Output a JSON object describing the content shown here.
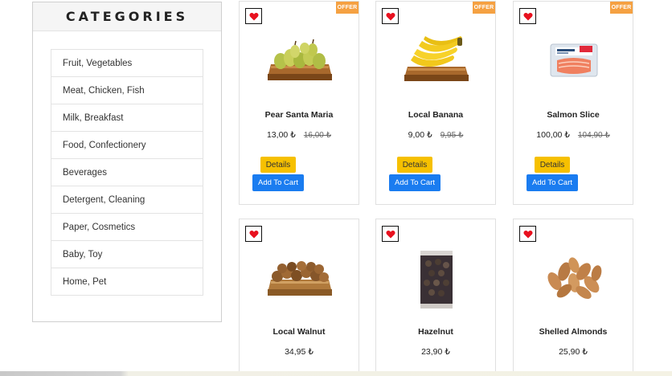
{
  "categories": {
    "title": "CATEGORIES",
    "items": [
      {
        "label": "Fruit, Vegetables"
      },
      {
        "label": "Meat, Chicken, Fish"
      },
      {
        "label": "Milk, Breakfast"
      },
      {
        "label": "Food, Confectionery"
      },
      {
        "label": "Beverages"
      },
      {
        "label": "Detergent, Cleaning"
      },
      {
        "label": "Paper, Cosmetics"
      },
      {
        "label": "Baby, Toy"
      },
      {
        "label": "Home, Pet"
      }
    ]
  },
  "products": [
    {
      "name": "Pear Santa Maria",
      "price": "13,00 ₺",
      "old_price": "16,00 ₺",
      "badge": "OFFER",
      "details_label": "Details",
      "cart_label": "Add To Cart"
    },
    {
      "name": "Local Banana",
      "price": "9,00 ₺",
      "old_price": "9,95 ₺",
      "badge": "OFFER",
      "details_label": "Details",
      "cart_label": "Add To Cart"
    },
    {
      "name": "Salmon Slice",
      "price": "100,00 ₺",
      "old_price": "104,90 ₺",
      "badge": "OFFER",
      "details_label": "Details",
      "cart_label": "Add To Cart"
    },
    {
      "name": "Local Walnut",
      "price": "34,95 ₺"
    },
    {
      "name": "Hazelnut",
      "price": "23,90 ₺"
    },
    {
      "name": "Shelled Almonds",
      "price": "25,90 ₺"
    }
  ],
  "icons": {
    "favorite": "heart-icon"
  },
  "colors": {
    "offer_badge": "#f5a142",
    "details_button": "#f6c000",
    "cart_button": "#1a7cf0",
    "heart": "#e8101e"
  }
}
